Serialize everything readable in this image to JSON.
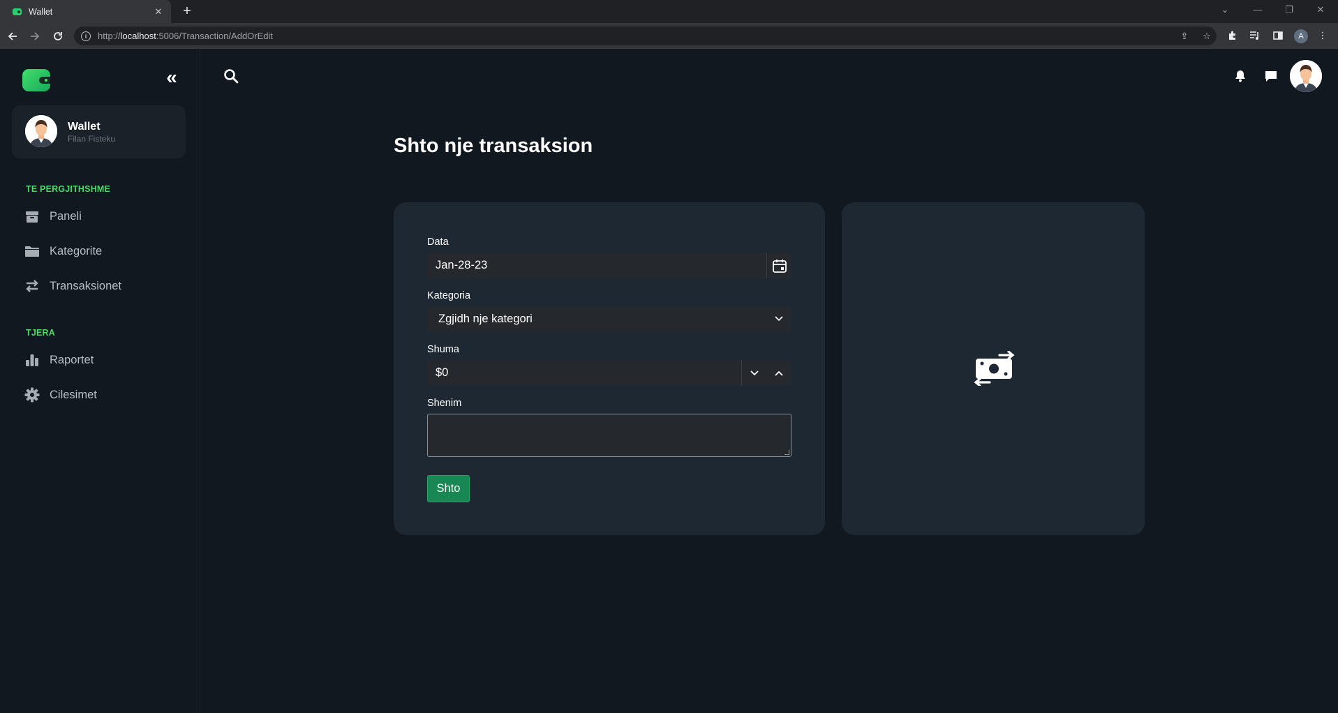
{
  "browser": {
    "tab_title": "Wallet",
    "url_prefix": "http://",
    "url_host": "localhost",
    "url_path": ":5006/Transaction/AddOrEdit",
    "profile_initial": "A"
  },
  "sidebar": {
    "user": {
      "name": "Wallet",
      "subtitle": "Filan Fisteku"
    },
    "sections": [
      {
        "label": "TE PERGJITHSHME",
        "items": [
          {
            "label": "Paneli",
            "icon": "box-icon"
          },
          {
            "label": "Kategorite",
            "icon": "folder-icon"
          },
          {
            "label": "Transaksionet",
            "icon": "arrows-icon"
          }
        ]
      },
      {
        "label": "TJERA",
        "items": [
          {
            "label": "Raportet",
            "icon": "bar-chart-icon"
          },
          {
            "label": "Cilesimet",
            "icon": "gear-icon"
          }
        ]
      }
    ]
  },
  "page": {
    "title": "Shto nje transaksion"
  },
  "form": {
    "date": {
      "label": "Data",
      "value": "Jan-28-23"
    },
    "category": {
      "label": "Kategoria",
      "value": "Zgjidh nje kategori"
    },
    "amount": {
      "label": "Shuma",
      "value": "$0"
    },
    "note": {
      "label": "Shenim",
      "value": ""
    },
    "submit_label": "Shto"
  },
  "colors": {
    "background": "#111820",
    "card": "#1e2832",
    "accent_green": "#4cd964",
    "button_green": "#198754"
  }
}
